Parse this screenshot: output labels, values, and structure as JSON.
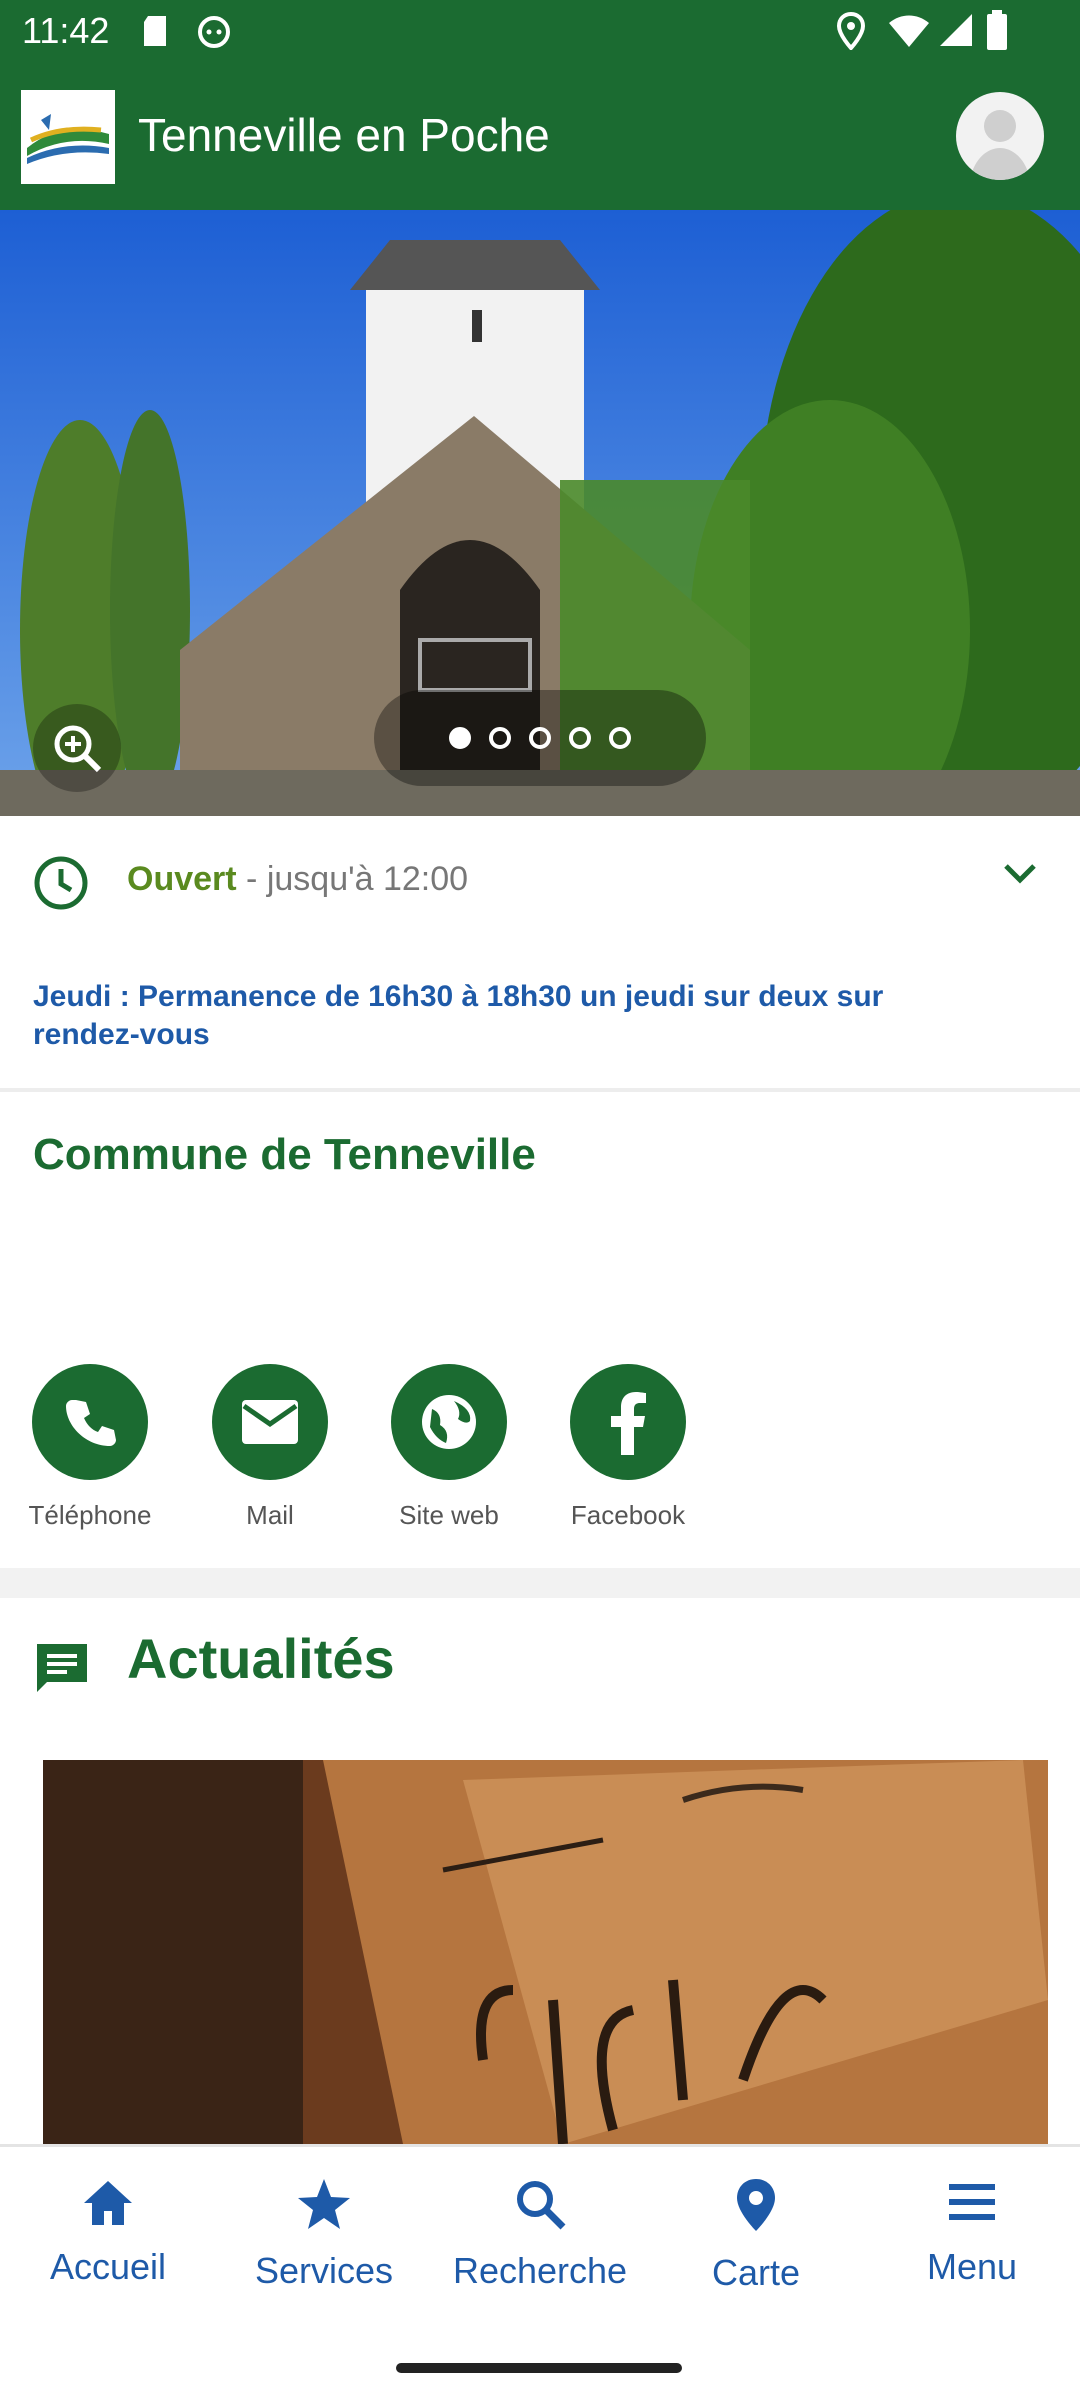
{
  "status_bar": {
    "time": "11:42"
  },
  "app_bar": {
    "title": "Tenneville en Poche"
  },
  "carousel": {
    "page_count": 5,
    "active_index": 0
  },
  "hours": {
    "status": "Ouvert",
    "detail": "- jusqu'à 12:00"
  },
  "notice": {
    "text": "Jeudi : Permanence de 16h30 à 18h30 un jeudi sur deux sur rendez-vous"
  },
  "place": {
    "name": "Commune de Tenneville"
  },
  "contacts": [
    {
      "label": "Téléphone",
      "icon": "phone-icon"
    },
    {
      "label": "Mail",
      "icon": "mail-icon"
    },
    {
      "label": "Site web",
      "icon": "globe-icon"
    },
    {
      "label": "Facebook",
      "icon": "facebook-icon"
    }
  ],
  "news": {
    "title": "Actualités"
  },
  "bottom_nav": [
    {
      "label": "Accueil",
      "icon": "home-icon"
    },
    {
      "label": "Services",
      "icon": "star-icon"
    },
    {
      "label": "Recherche",
      "icon": "search-icon"
    },
    {
      "label": "Carte",
      "icon": "map-pin-icon"
    },
    {
      "label": "Menu",
      "icon": "menu-icon"
    }
  ],
  "colors": {
    "primary": "#1b6b31",
    "accent_blue": "#1e5aa8",
    "open_green": "#5a8a1f"
  }
}
